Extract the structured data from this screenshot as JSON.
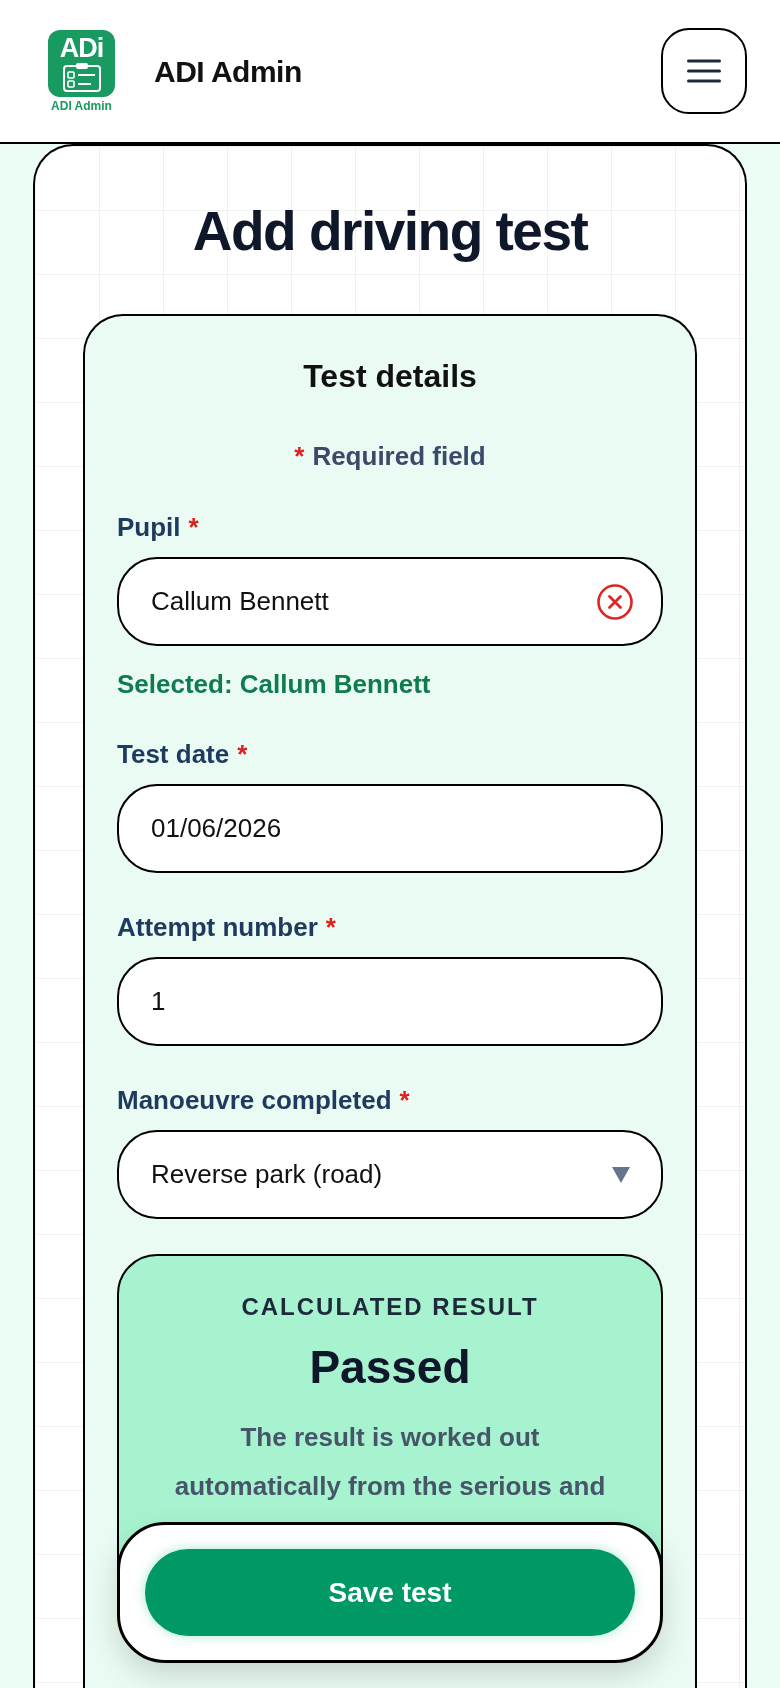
{
  "header": {
    "logo": {
      "mark": "ADi",
      "caption": "ADI Admin"
    },
    "title": "ADI Admin"
  },
  "page": {
    "title": "Add driving test"
  },
  "form": {
    "title": "Test details",
    "required_mark": "*",
    "required_note": "Required field",
    "fields": [
      {
        "kind": "search",
        "label": "Pupil",
        "required": true,
        "value": "Callum Bennett",
        "note": "Selected: Callum Bennett"
      },
      {
        "kind": "text",
        "label": "Test date",
        "required": true,
        "value": "01/06/2026"
      },
      {
        "kind": "text",
        "label": "Attempt number",
        "required": true,
        "value": "1"
      },
      {
        "kind": "select",
        "label": "Manoeuvre completed",
        "required": true,
        "value": "Reverse park (road)"
      }
    ]
  },
  "result": {
    "heading": "CALCULATED RESULT",
    "value": "Passed",
    "description": "The result is worked out automatically from the serious and"
  },
  "save_button": {
    "label": "Save test"
  }
}
